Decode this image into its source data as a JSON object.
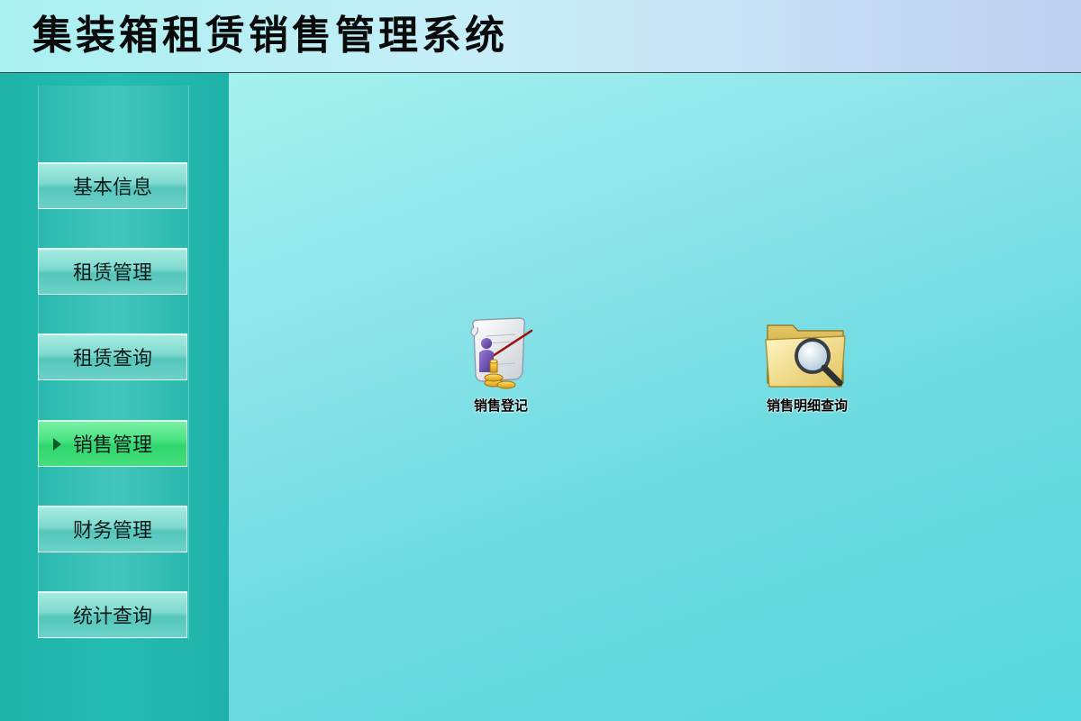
{
  "header": {
    "title": "集装箱租赁销售管理系统"
  },
  "sidebar": {
    "items": [
      {
        "label": "基本信息",
        "active": false
      },
      {
        "label": "租赁管理",
        "active": false
      },
      {
        "label": "租赁查询",
        "active": false
      },
      {
        "label": "销售管理",
        "active": true
      },
      {
        "label": "财务管理",
        "active": false
      },
      {
        "label": "统计查询",
        "active": false
      }
    ]
  },
  "main": {
    "launchers": [
      {
        "label": "销售登记",
        "icon": "sales-register-icon"
      },
      {
        "label": "销售明细查询",
        "icon": "folder-search-icon"
      }
    ]
  },
  "colors": {
    "sidebar_bg": "#22b8ae",
    "active_item": "#3fdc78",
    "main_bg": "#6cdbe0"
  }
}
